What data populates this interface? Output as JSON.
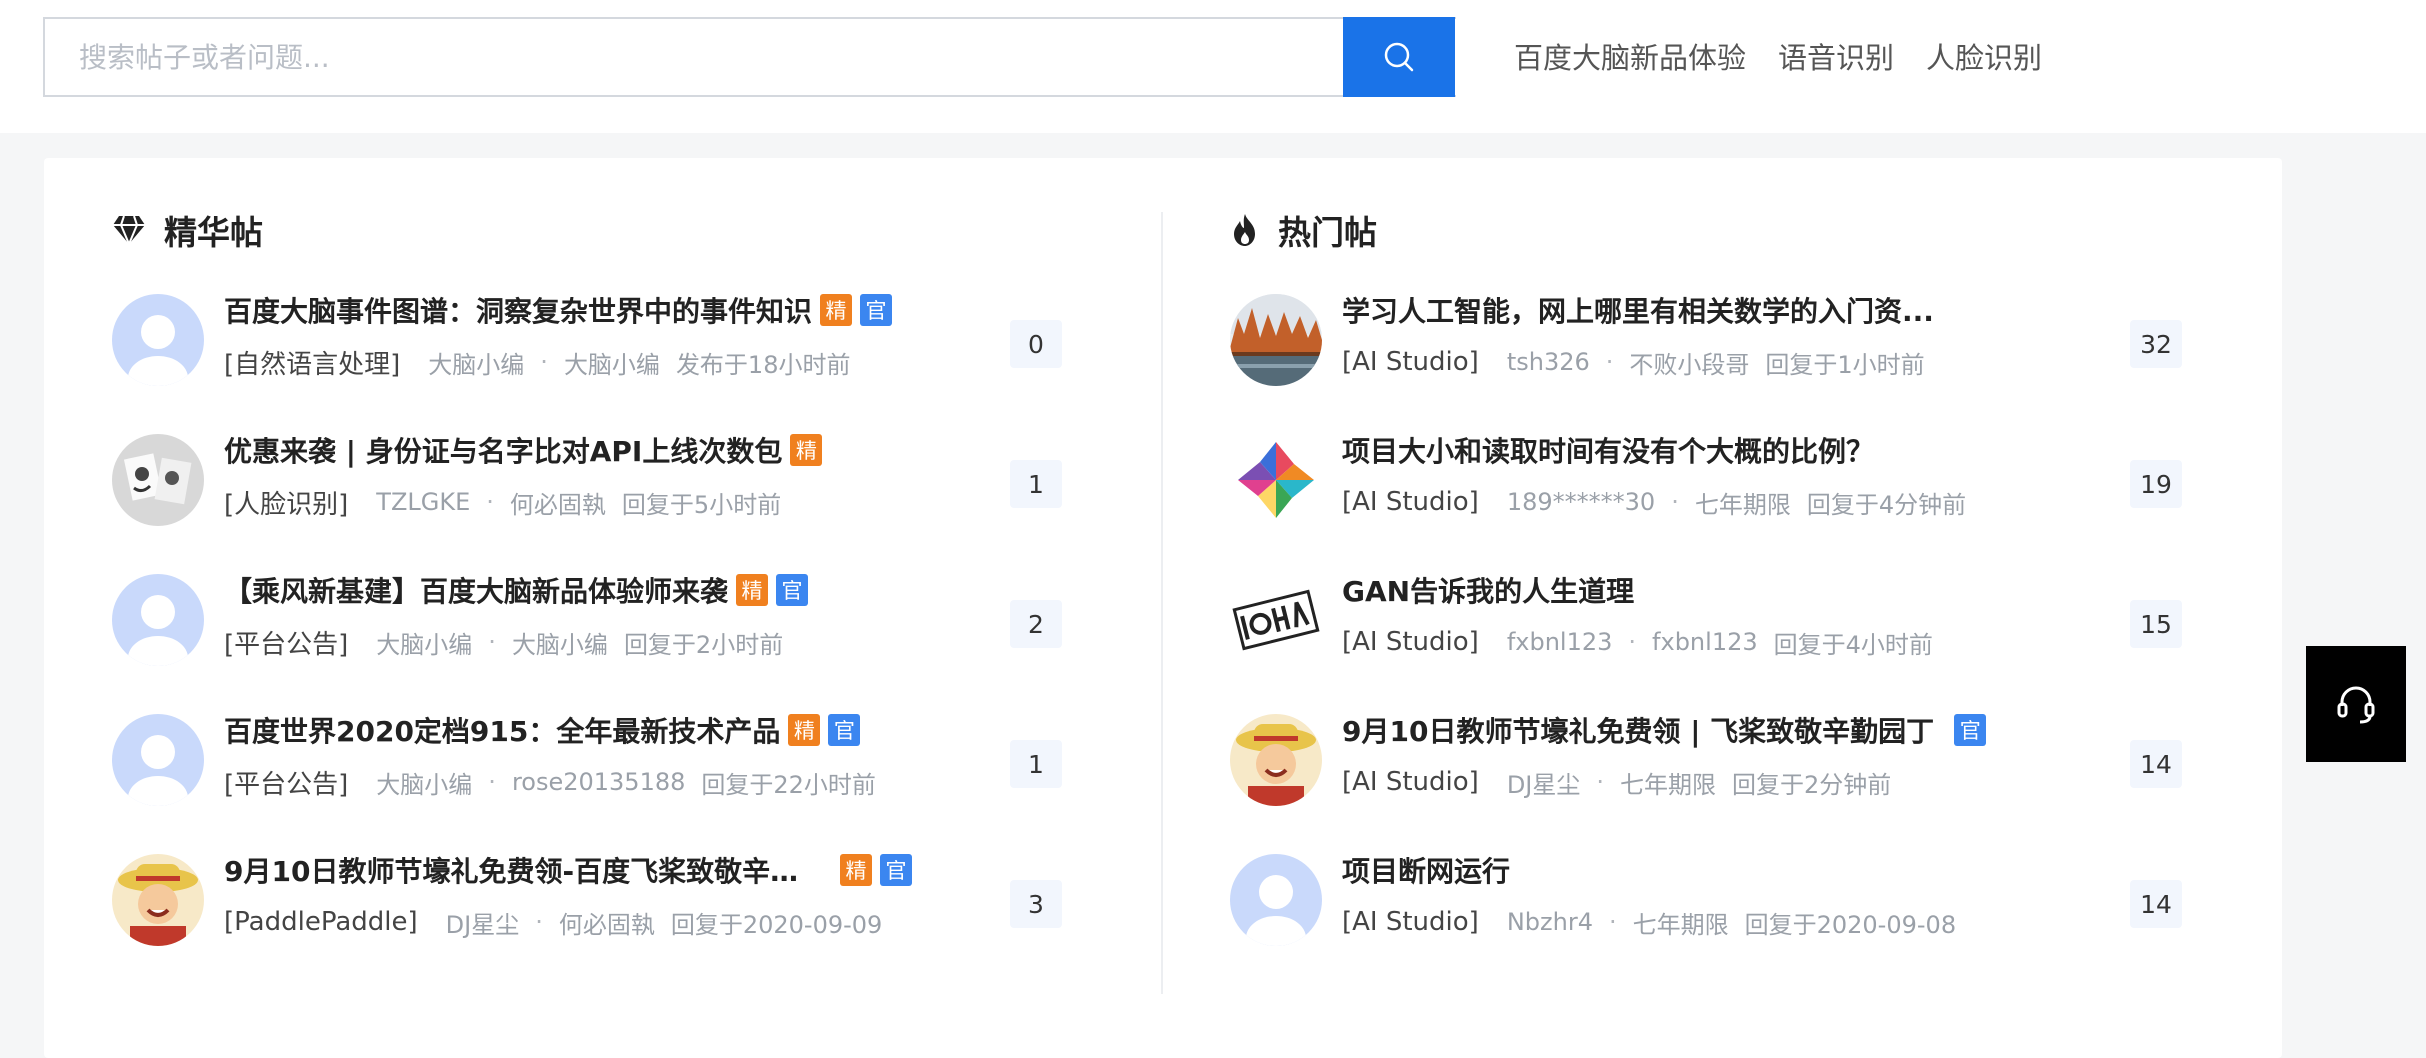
{
  "search": {
    "placeholder": "搜索帖子或者问题..."
  },
  "nav": [
    "百度大脑新品体验",
    "语音识别",
    "人脸识别"
  ],
  "featured": {
    "title": "精华帖",
    "posts": [
      {
        "title": "百度大脑事件图谱：洞察复杂世界中的事件知识",
        "tags": [
          "精",
          "官"
        ],
        "category": "[自然语言处理]",
        "author": "大脑小编",
        "last_user": "大脑小编",
        "time": "发布于18小时前",
        "count": "0",
        "avatar": "default"
      },
      {
        "title": "优惠来袭 | 身份证与名字比对API上线次数包",
        "tags": [
          "精"
        ],
        "category": "[人脸识别]",
        "author": "TZLGKE",
        "last_user": "何必固執",
        "time": "回复于5小时前",
        "count": "1",
        "avatar": "photo-gray"
      },
      {
        "title": "【乘风新基建】百度大脑新品体验师来袭",
        "tags": [
          "精",
          "官"
        ],
        "category": "[平台公告]",
        "author": "大脑小编",
        "last_user": "大脑小编",
        "time": "回复于2小时前",
        "count": "2",
        "avatar": "default"
      },
      {
        "title": "百度世界2020定档915：全年最新技术产品",
        "tags": [
          "精",
          "官"
        ],
        "category": "[平台公告]",
        "author": "大脑小编",
        "last_user": "rose20135188",
        "time": "回复于22小时前",
        "count": "1",
        "avatar": "default"
      },
      {
        "title": "9月10日教师节壕礼免费领-百度飞桨致敬辛勤...",
        "tags": [
          "精",
          "官"
        ],
        "category": "[PaddlePaddle]",
        "author": "DJ星尘",
        "last_user": "何必固執",
        "time": "回复于2020-09-09",
        "count": "3",
        "avatar": "luffy"
      }
    ]
  },
  "hot": {
    "title": "热门帖",
    "posts": [
      {
        "title": "学习人工智能，网上哪里有相关数学的入门资...",
        "tags": [],
        "category": "[AI Studio]",
        "author": "tsh326",
        "last_user": "不败小段哥",
        "time": "回复于1小时前",
        "count": "32",
        "avatar": "landscape"
      },
      {
        "title": "项目大小和读取时间有没有个大概的比例？",
        "tags": [],
        "category": "[AI Studio]",
        "author": "189******30",
        "last_user": "七年期限",
        "time": "回复于4分钟前",
        "count": "19",
        "avatar": "pinwheel"
      },
      {
        "title": "GAN告诉我的人生道理",
        "tags": [],
        "category": "[AI Studio]",
        "author": "fxbnl123",
        "last_user": "fxbnl123",
        "time": "回复于4小时前",
        "count": "15",
        "avatar": "text-logo"
      },
      {
        "title": "9月10日教师节壕礼免费领 | 飞桨致敬辛勤园丁",
        "tags": [
          "官"
        ],
        "category": "[AI Studio]",
        "author": "DJ星尘",
        "last_user": "七年期限",
        "time": "回复于2分钟前",
        "count": "14",
        "avatar": "luffy"
      },
      {
        "title": "项目断网运行",
        "tags": [],
        "category": "[AI Studio]",
        "author": "Nbzhr4",
        "last_user": "七年期限",
        "time": "回复于2020-09-08",
        "count": "14",
        "avatar": "default"
      }
    ]
  },
  "colors": {
    "accent": "#1a73e8",
    "tag_jing": "#f0801f",
    "tag_guan": "#3b86f0"
  },
  "icons": {
    "search": "search-icon",
    "featured": "diamond-icon",
    "hot": "fire-icon",
    "helpdesk": "headset-icon"
  }
}
